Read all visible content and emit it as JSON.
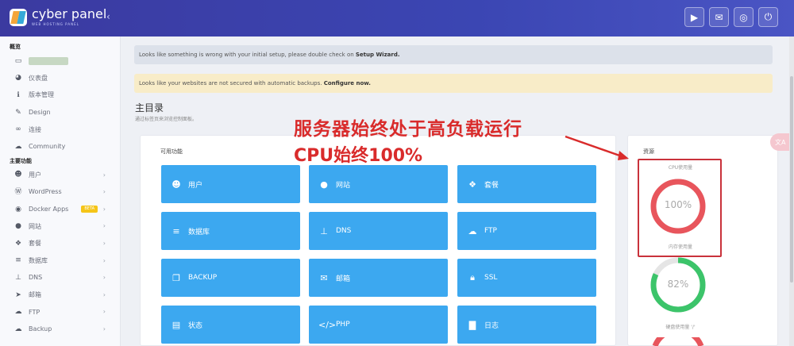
{
  "header": {
    "brand": "cyber panel",
    "brand_sub": "WEB HOSTING PANEL",
    "collapse_icon": "chevron-left-icon",
    "icons": [
      "youtube-icon",
      "chat-icon",
      "support-icon",
      "power-icon"
    ]
  },
  "sidebar": {
    "section1": "概览",
    "overview_items": [
      {
        "icon": "laptop-icon",
        "label": ""
      },
      {
        "icon": "palette-icon",
        "label": "仪表盘"
      },
      {
        "icon": "info-icon",
        "label": "版本管理"
      },
      {
        "icon": "paint-icon",
        "label": "Design"
      },
      {
        "icon": "link-icon",
        "label": "连接"
      },
      {
        "icon": "comments-icon",
        "label": "Community"
      }
    ],
    "section2": "主要功能",
    "main_items": [
      {
        "icon": "users-icon",
        "label": "用户"
      },
      {
        "icon": "wordpress-icon",
        "label": "WordPress"
      },
      {
        "icon": "docker-icon",
        "label": "Docker Apps",
        "badge": "BETA"
      },
      {
        "icon": "globe-icon",
        "label": "网站"
      },
      {
        "icon": "cubes-icon",
        "label": "套餐"
      },
      {
        "icon": "database-icon",
        "label": "数据库"
      },
      {
        "icon": "sitemap-icon",
        "label": "DNS"
      },
      {
        "icon": "paper-plane-icon",
        "label": "邮箱"
      },
      {
        "icon": "cloud-upload-icon",
        "label": "FTP"
      },
      {
        "icon": "cloud-icon",
        "label": "Backup"
      }
    ]
  },
  "alerts": {
    "info_text": "Looks like something is wrong with your initial setup, please double check on ",
    "info_link": "Setup Wizard.",
    "warn_text": "Looks like your websites are not secured with automatic backups. ",
    "warn_link": "Configure now."
  },
  "main": {
    "title": "主目录",
    "subtitle": "通过标签页来浏览控制面板。",
    "functions_title": "可用功能",
    "tiles": [
      {
        "icon": "users-icon",
        "label": "用户"
      },
      {
        "icon": "globe-icon",
        "label": "网站"
      },
      {
        "icon": "cubes-icon",
        "label": "套餐"
      },
      {
        "icon": "database-icon",
        "label": "数据库"
      },
      {
        "icon": "sitemap-icon",
        "label": "DNS"
      },
      {
        "icon": "cloud-upload-icon",
        "label": "FTP"
      },
      {
        "icon": "clone-icon",
        "label": "BACKUP"
      },
      {
        "icon": "envelope-icon",
        "label": "邮箱"
      },
      {
        "icon": "lock-icon",
        "label": "SSL"
      },
      {
        "icon": "list-icon",
        "label": "状态"
      },
      {
        "icon": "code-icon",
        "label": "PHP"
      },
      {
        "icon": "file-icon",
        "label": "日志"
      }
    ]
  },
  "resources": {
    "title": "资源",
    "cpu_label": "CPU使用量",
    "cpu_value": "100%",
    "cpu_percent": 100,
    "mem_label": "内存使用量",
    "mem_value": "82%",
    "mem_percent": 82,
    "disk_label": "硬盘使用量 '/'",
    "colors": {
      "cpu": "#e8555c",
      "mem": "#3cc46a",
      "track": "#e5e5e5",
      "disk": "#e8555c"
    }
  },
  "annotation": {
    "line1": "服务器始终处于高负载运行",
    "line2": "CPU始终100%",
    "color": "#d92b2b"
  },
  "colors": {
    "tile": "#3ca8f0",
    "header": "#3b3aa0"
  }
}
